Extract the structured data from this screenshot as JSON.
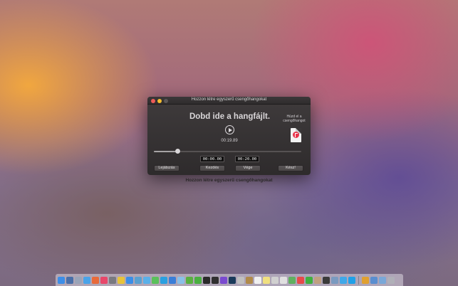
{
  "window": {
    "title": "Hozzon létre egyszerű csengőhangokat"
  },
  "main": {
    "drop_label": "Dobd ide a hangfájlt.",
    "duration": "00:19.89",
    "drag_hint": "Húzd el a csengőhangot",
    "slider_position": 0.16,
    "start_time": "00:00.00",
    "end_time": "00:20.00"
  },
  "buttons": {
    "play": "Lejátszás",
    "start": "Kezdés",
    "end": "Vége",
    "done": "Kész!"
  },
  "caption": "Hozzon létre egyszerű csengőhangokat",
  "dock": {
    "icons": [
      {
        "name": "finder-icon",
        "color": "#3d8ee8"
      },
      {
        "name": "dashboard-icon",
        "color": "#4a6fa8"
      },
      {
        "name": "launchpad-icon",
        "color": "#9aa4b8"
      },
      {
        "name": "safari-icon",
        "color": "#4aa3e8"
      },
      {
        "name": "photos-icon",
        "color": "#e86a3a"
      },
      {
        "name": "itunes-icon",
        "color": "#e8476a"
      },
      {
        "name": "settings-icon",
        "color": "#7a7a80"
      },
      {
        "name": "chrome-icon",
        "color": "#e8c33a"
      },
      {
        "name": "app-store-icon",
        "color": "#3a8ee8"
      },
      {
        "name": "xcode-icon",
        "color": "#5aa0d0"
      },
      {
        "name": "mail-icon",
        "color": "#5ab0e8"
      },
      {
        "name": "messages-icon",
        "color": "#5ac05a"
      },
      {
        "name": "skype-icon",
        "color": "#2aa0e0"
      },
      {
        "name": "dropbox-icon",
        "color": "#3a7ed8"
      },
      {
        "name": "cloud-icon",
        "color": "#8ac0e8"
      },
      {
        "name": "leaf-icon",
        "color": "#5ab040"
      },
      {
        "name": "evernote-icon",
        "color": "#4ab040"
      },
      {
        "name": "terminal-icon",
        "color": "#2a2a2a"
      },
      {
        "name": "dark-app-icon",
        "color": "#303030"
      },
      {
        "name": "visual-studio-icon",
        "color": "#7a4ad0"
      },
      {
        "name": "photoshop-icon",
        "color": "#1a3a5a"
      },
      {
        "name": "lock-icon",
        "color": "#c0c0c0"
      },
      {
        "name": "archive-icon",
        "color": "#b08a4a"
      },
      {
        "name": "calendar-icon",
        "color": "#f0f0f0"
      },
      {
        "name": "notes-icon",
        "color": "#f0e080"
      },
      {
        "name": "preview-icon",
        "color": "#d0d0d0"
      },
      {
        "name": "textedit-icon",
        "color": "#e0e0e0"
      },
      {
        "name": "maps-icon",
        "color": "#60b060"
      },
      {
        "name": "music-app-icon",
        "color": "#e84a4a"
      },
      {
        "name": "facetime-icon",
        "color": "#40b040"
      },
      {
        "name": "contacts-icon",
        "color": "#c0a080"
      },
      {
        "name": "game-icon",
        "color": "#3a3a3a"
      },
      {
        "name": "monitor-icon",
        "color": "#7a9ac0"
      },
      {
        "name": "twitter-icon",
        "color": "#40a8e8"
      },
      {
        "name": "skype-blue-icon",
        "color": "#20a0e8"
      },
      {
        "name": "flag-icon",
        "color": "#e0a030"
      },
      {
        "name": "downloads-icon",
        "color": "#5a8ed0"
      },
      {
        "name": "documents-icon",
        "color": "#7aa8d8"
      },
      {
        "name": "trash-icon",
        "color": "#b0b0b8"
      }
    ]
  }
}
